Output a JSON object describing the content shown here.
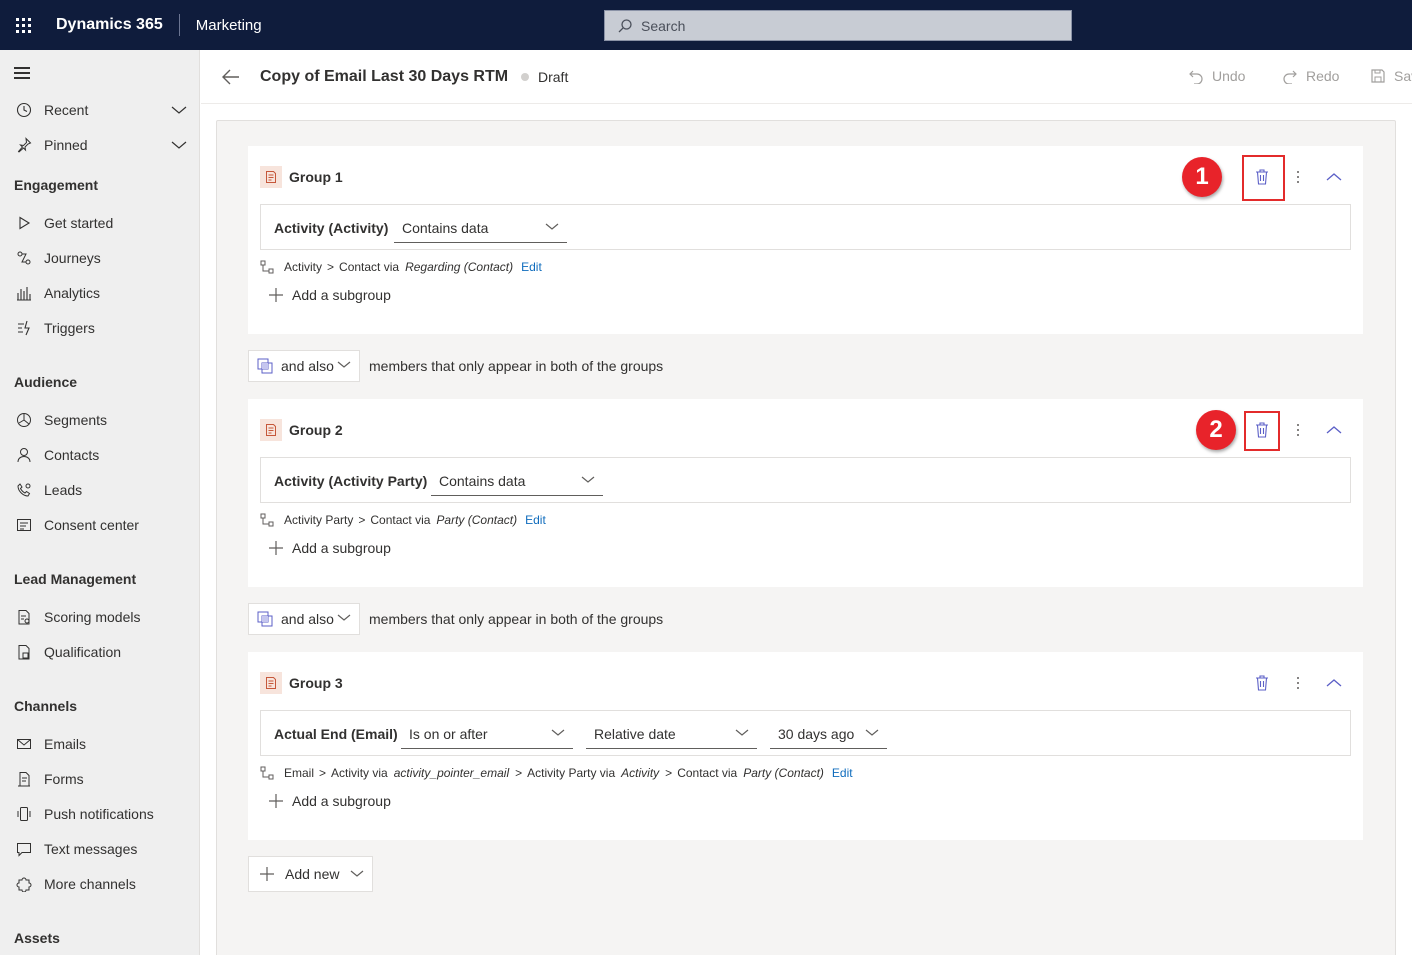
{
  "header": {
    "brand": "Dynamics 365",
    "app": "Marketing",
    "search_placeholder": "Search"
  },
  "sidebar": {
    "top_items": [
      {
        "label": "Recent",
        "icon": "clock-icon"
      },
      {
        "label": "Pinned",
        "icon": "pin-icon"
      }
    ],
    "sections": [
      {
        "title": "Engagement",
        "items": [
          {
            "label": "Get started",
            "icon": "play-icon"
          },
          {
            "label": "Journeys",
            "icon": "journey-icon"
          },
          {
            "label": "Analytics",
            "icon": "analytics-icon"
          },
          {
            "label": "Triggers",
            "icon": "trigger-icon"
          }
        ]
      },
      {
        "title": "Audience",
        "items": [
          {
            "label": "Segments",
            "icon": "segments-icon"
          },
          {
            "label": "Contacts",
            "icon": "person-icon"
          },
          {
            "label": "Leads",
            "icon": "phone-icon"
          },
          {
            "label": "Consent center",
            "icon": "consent-icon"
          }
        ]
      },
      {
        "title": "Lead Management",
        "items": [
          {
            "label": "Scoring models",
            "icon": "scoring-icon"
          },
          {
            "label": "Qualification",
            "icon": "qualification-icon"
          }
        ]
      },
      {
        "title": "Channels",
        "items": [
          {
            "label": "Emails",
            "icon": "mail-icon"
          },
          {
            "label": "Forms",
            "icon": "form-icon"
          },
          {
            "label": "Push notifications",
            "icon": "mobile-icon"
          },
          {
            "label": "Text messages",
            "icon": "chat-icon"
          },
          {
            "label": "More channels",
            "icon": "puzzle-icon"
          }
        ]
      },
      {
        "title": "Assets",
        "items": []
      }
    ]
  },
  "command_bar": {
    "title": "Copy of Email Last 30 Days RTM",
    "status": "Draft",
    "undo": "Undo",
    "redo": "Redo",
    "save": "Sav"
  },
  "groups": [
    {
      "title": "Group 1",
      "field": "Activity (Activity)",
      "operator": "Contains data",
      "path": {
        "from": "Activity",
        "to": "Contact via",
        "via": "Regarding (Contact)",
        "edit": "Edit"
      },
      "add_subgroup": "Add a subgroup",
      "badge": "1"
    },
    {
      "title": "Group 2",
      "field": "Activity (Activity Party)",
      "operator": "Contains data",
      "path": {
        "from": "Activity Party",
        "to": "Contact via",
        "via": "Party (Contact)",
        "edit": "Edit"
      },
      "add_subgroup": "Add a subgroup",
      "badge": "2"
    },
    {
      "title": "Group 3",
      "field": "Actual End (Email)",
      "operator": "Is on or after",
      "date_type": "Relative date",
      "date_value": "30 days ago",
      "path": {
        "seg1": "Email",
        "seg2": "Activity via",
        "seg2_em": "activity_pointer_email",
        "seg3": "Activity Party via",
        "seg3_em": "Activity",
        "seg4": "Contact via",
        "seg4_em": "Party (Contact)",
        "edit": "Edit"
      },
      "add_subgroup": "Add a subgroup"
    }
  ],
  "combiner": {
    "label": "and also",
    "text": "members that only appear in both of the groups"
  },
  "add_new": "Add new",
  "colors": {
    "topbar": "#0f1c3c",
    "accent_link": "#0f6cbd",
    "annotation_red": "#e8232a"
  }
}
